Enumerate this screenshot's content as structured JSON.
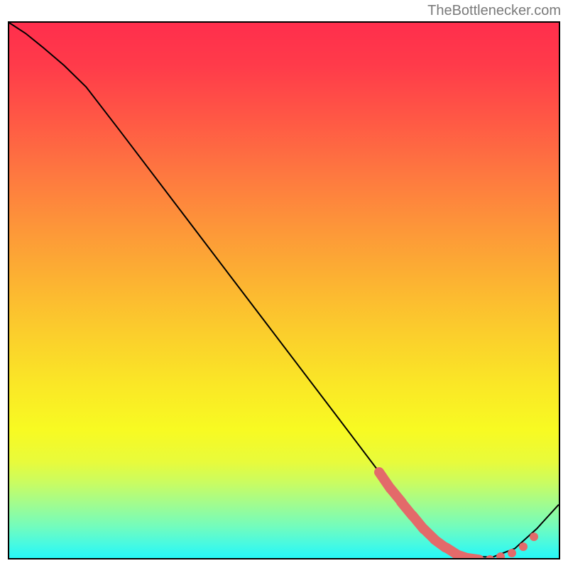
{
  "attribution": "TheBottlenecker.com",
  "chart_data": {
    "type": "line",
    "title": "",
    "xlabel": "",
    "ylabel": "",
    "xlim": [
      0,
      100
    ],
    "ylim": [
      0,
      100
    ],
    "background": "rainbow-vertical-gradient",
    "series": [
      {
        "name": "bottleneck-curve",
        "color": "#000000",
        "x": [
          0,
          3,
          6,
          10,
          14,
          20,
          30,
          40,
          50,
          60,
          67,
          72,
          76,
          80,
          84,
          88,
          92,
          96,
          100
        ],
        "y": [
          100,
          98,
          95.5,
          92,
          88,
          80,
          66.5,
          53,
          39.5,
          26,
          16.5,
          9.5,
          4.5,
          1.5,
          0.3,
          0.2,
          1.8,
          5.5,
          10
        ]
      }
    ],
    "markers": {
      "name": "optimal-zone-markers",
      "color": "#e36a6a",
      "points": [
        {
          "x": 67,
          "y": 16.5
        },
        {
          "x": 69,
          "y": 13.5
        },
        {
          "x": 71,
          "y": 11
        },
        {
          "x": 73,
          "y": 8.5
        },
        {
          "x": 75,
          "y": 6
        },
        {
          "x": 77,
          "y": 4
        },
        {
          "x": 79,
          "y": 2.5
        },
        {
          "x": 81,
          "y": 1.2
        },
        {
          "x": 83,
          "y": 0.5
        },
        {
          "x": 85,
          "y": 0.2
        },
        {
          "x": 87,
          "y": 0.3
        },
        {
          "x": 89,
          "y": 0.8
        },
        {
          "x": 91,
          "y": 1.5
        },
        {
          "x": 93,
          "y": 2.7
        },
        {
          "x": 95,
          "y": 4.5
        }
      ]
    }
  }
}
